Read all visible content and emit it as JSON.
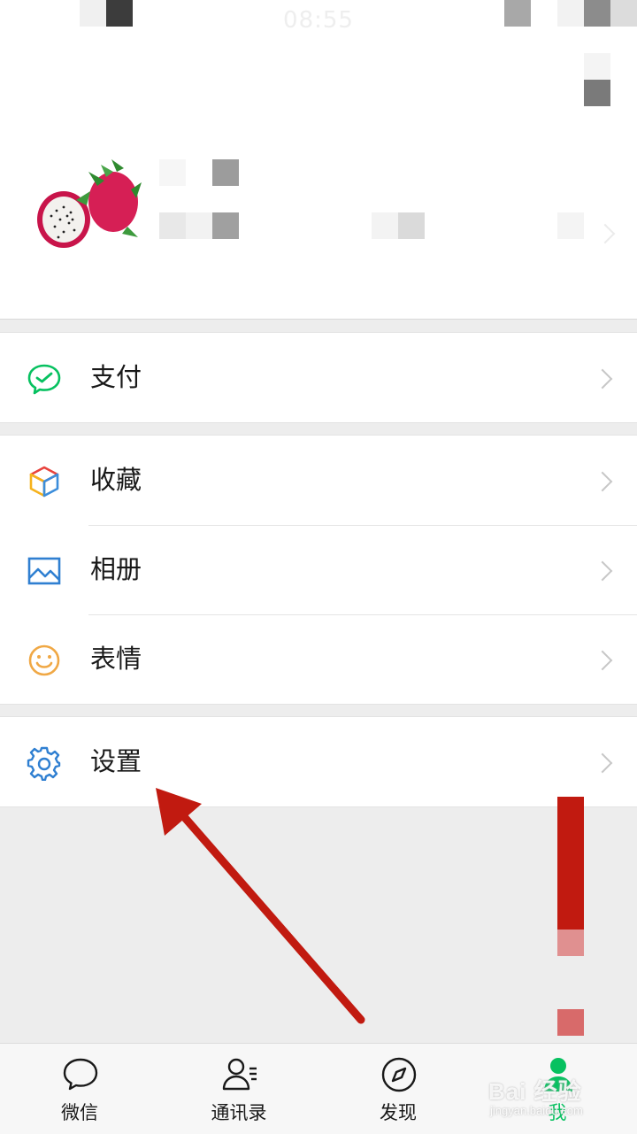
{
  "status_bar": {
    "time": "08:55"
  },
  "menu": {
    "pay": {
      "label": "支付",
      "icon": "wechat-pay-icon"
    },
    "favorites": {
      "label": "收藏",
      "icon": "cube-icon"
    },
    "album": {
      "label": "相册",
      "icon": "photo-album-icon"
    },
    "stickers": {
      "label": "表情",
      "icon": "smiley-icon"
    },
    "settings": {
      "label": "设置",
      "icon": "gear-icon"
    }
  },
  "tabbar": {
    "tabs": [
      {
        "label": "微信",
        "icon": "chat-bubble-icon"
      },
      {
        "label": "通讯录",
        "icon": "contacts-icon"
      },
      {
        "label": "发现",
        "icon": "compass-icon"
      },
      {
        "label": "我",
        "icon": "person-icon",
        "active": true
      }
    ]
  },
  "watermark": {
    "brand": "Bai 经验",
    "url": "jingyan.baidu.com"
  },
  "colors": {
    "accent_green": "#07c160",
    "annotation_red": "#c11a10",
    "background": "#ededed"
  }
}
